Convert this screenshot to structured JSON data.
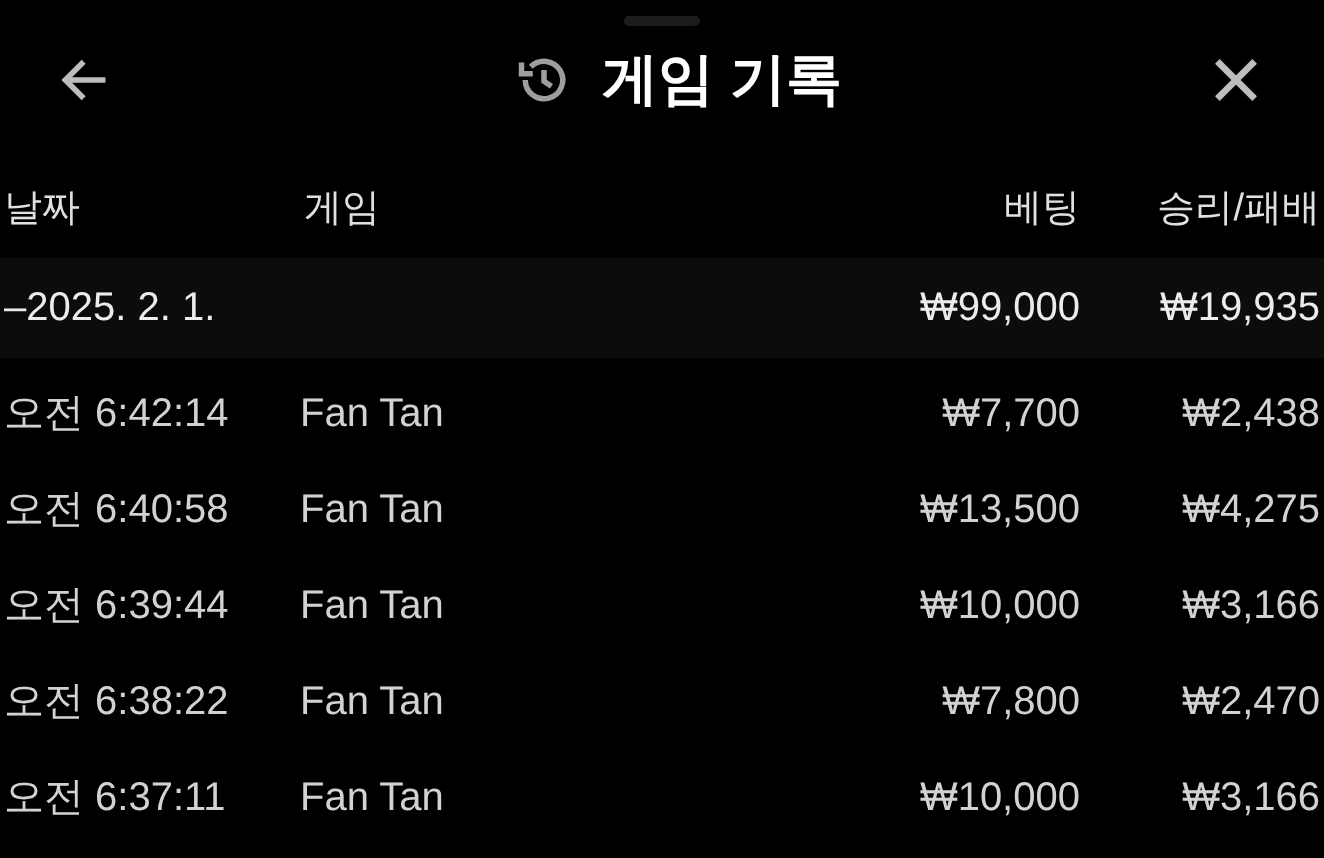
{
  "header": {
    "title": "게임 기록"
  },
  "columns": [
    "날짜",
    "게임",
    "베팅",
    "승리/패배"
  ],
  "group": {
    "date": "–2025. 2. 1.",
    "bet": "₩99,000",
    "result": "₩19,935"
  },
  "rows": [
    {
      "time": "오전 6:42:14",
      "game": "Fan Tan",
      "bet": "₩7,700",
      "result": "₩2,438"
    },
    {
      "time": "오전 6:40:58",
      "game": "Fan Tan",
      "bet": "₩13,500",
      "result": "₩4,275"
    },
    {
      "time": "오전 6:39:44",
      "game": "Fan Tan",
      "bet": "₩10,000",
      "result": "₩3,166"
    },
    {
      "time": "오전 6:38:22",
      "game": "Fan Tan",
      "bet": "₩7,800",
      "result": "₩2,470"
    },
    {
      "time": "오전 6:37:11",
      "game": "Fan Tan",
      "bet": "₩10,000",
      "result": "₩3,166"
    }
  ]
}
